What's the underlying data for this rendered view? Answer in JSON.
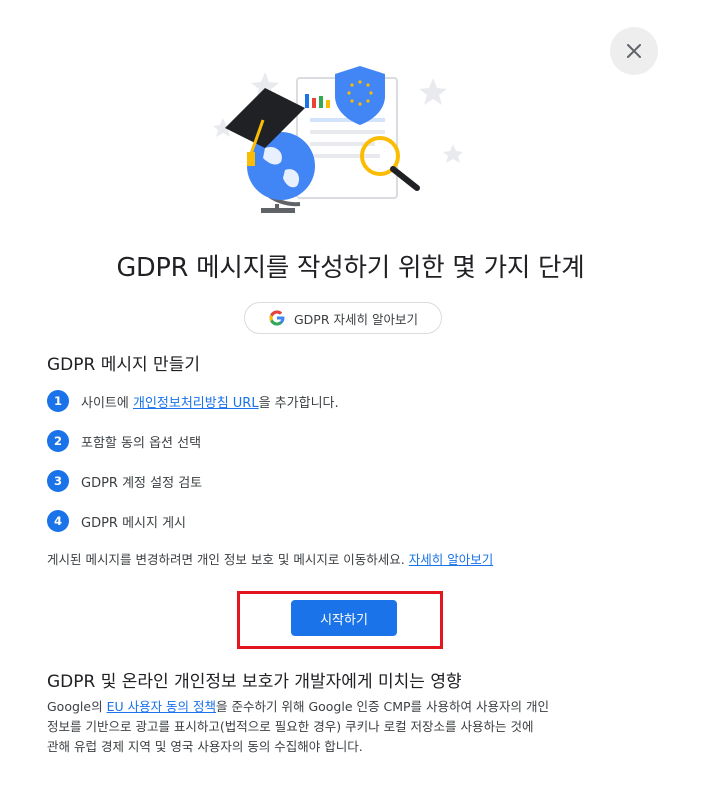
{
  "dialog": {
    "close_icon": "close-icon",
    "title": "GDPR 메시지를 작성하기 위한 몇 가지 단계",
    "learn_chip": {
      "icon": "google-g-icon",
      "label": "GDPR 자세히 알아보기"
    }
  },
  "create_section": {
    "title": "GDPR 메시지 만들기",
    "steps": [
      {
        "num": "1",
        "before": "사이트에 ",
        "link": "개인정보처리방침 URL",
        "after": "을 추가합니다."
      },
      {
        "num": "2",
        "text": "포함할 동의 옵션 선택"
      },
      {
        "num": "3",
        "text": "GDPR 계정 설정 검토"
      },
      {
        "num": "4",
        "text": "GDPR 메시지 게시"
      }
    ],
    "note": "게시된 메시지를 변경하려면 개인 정보 보호 및 메시지로 이동하세요.",
    "note_link": "자세히 알아보기",
    "start_button": "시작하기"
  },
  "impact_section": {
    "title": "GDPR 및 온라인 개인정보 보호가 개발자에게 미치는 영향",
    "para_before": "Google의 ",
    "para_link": "EU 사용자 동의 정책",
    "para_line1_after": "을 준수하기 위해 Google 인증 CMP를 사용하여 사용자의 개인",
    "para_line2": "정보를 기반으로 광고를 표시하고(법적으로 필요한 경우) 쿠키나 로컬 저장소를 사용하는 것에",
    "para_line3": "관해 유럽 경제 지역 및 영국 사용자의 동의 수집해야 합니다."
  },
  "colors": {
    "primary": "#1a73e8",
    "highlight": "#e3161f"
  }
}
